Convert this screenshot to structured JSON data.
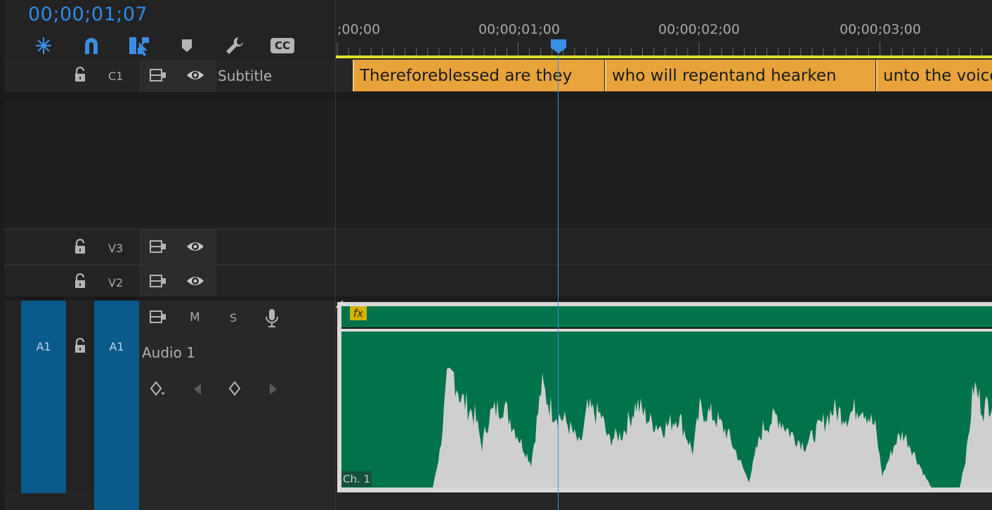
{
  "header": {
    "timecode": "00;00;01;07"
  },
  "tools": [
    {
      "name": "snap-insert-icon"
    },
    {
      "name": "magnet-icon"
    },
    {
      "name": "linked-selection-icon"
    },
    {
      "name": "marker-icon"
    },
    {
      "name": "wrench-icon"
    },
    {
      "name": "cc-icon",
      "label": "CC"
    }
  ],
  "tracks": {
    "c1": {
      "id": "C1",
      "name": "Subtitle"
    },
    "v3": {
      "id": "V3"
    },
    "v2": {
      "id": "V2"
    },
    "a1": {
      "source": "A1",
      "id": "A1",
      "name": "Audio 1",
      "mute": "M",
      "solo": "S"
    }
  },
  "ruler": {
    "labels": [
      ";00;00",
      "00;00;01;00",
      "00;00;02;00",
      "00;00;03;00"
    ]
  },
  "captions": [
    "Thereforeblessed are they",
    "who will repentand hearken",
    "unto the voice"
  ],
  "audio_clip": {
    "fx": "fx",
    "channel": "Ch. 1"
  },
  "colors": {
    "accent": "#2e8ce8",
    "caption": "#e8a33b",
    "audio_clip": "#00734a",
    "track_target": "#0a5a8c",
    "work_area": "#e0e028"
  }
}
